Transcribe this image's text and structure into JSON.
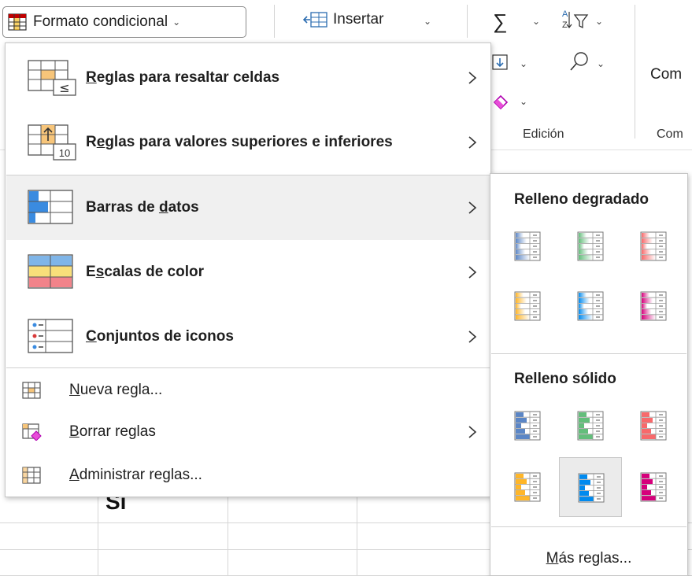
{
  "ribbon": {
    "conditional_format_label": "Formato condicional",
    "insert_label": "Insertar",
    "comment_label": "Com",
    "editing_group_label": "Edición",
    "comments_group_label": "Com"
  },
  "grid": {
    "cell_text": "Sí"
  },
  "menu": {
    "items": [
      {
        "pre": "",
        "key": "R",
        "post": "eglas para resaltar celdas",
        "icon": "highlight-cells-rules-icon"
      },
      {
        "pre": "R",
        "key": "e",
        "post": "glas para valores superiores e inferiores",
        "icon": "top-bottom-rules-icon"
      },
      {
        "pre": "Barras de ",
        "key": "d",
        "post": "atos",
        "icon": "data-bars-icon"
      },
      {
        "pre": "E",
        "key": "s",
        "post": "calas de color",
        "icon": "color-scales-icon"
      },
      {
        "pre": "",
        "key": "C",
        "post": "onjuntos de iconos",
        "icon": "icon-sets-icon"
      }
    ],
    "actions": [
      {
        "pre": "",
        "key": "N",
        "post": "ueva regla...",
        "icon": "new-rule-icon"
      },
      {
        "pre": "",
        "key": "B",
        "post": "orrar reglas",
        "icon": "clear-rules-icon"
      },
      {
        "pre": "",
        "key": "A",
        "post": "dministrar reglas...",
        "icon": "manage-rules-icon"
      }
    ]
  },
  "submenu": {
    "gradient_heading": "Relleno degradado",
    "solid_heading": "Relleno sólido",
    "more_pre": "",
    "more_key": "M",
    "more_post": "ás reglas...",
    "colors": {
      "blue": "#5b86c6",
      "green": "#63be7b",
      "red": "#f8696b",
      "orange": "#ffb628",
      "light_blue": "#008aef",
      "purple": "#d6007b"
    },
    "gradient_swatches": [
      "blue",
      "green",
      "red",
      "orange",
      "light_blue",
      "purple"
    ],
    "solid_swatches": [
      "blue",
      "green",
      "red",
      "orange",
      "light_blue",
      "purple"
    ],
    "selected": "solid-light_blue"
  }
}
